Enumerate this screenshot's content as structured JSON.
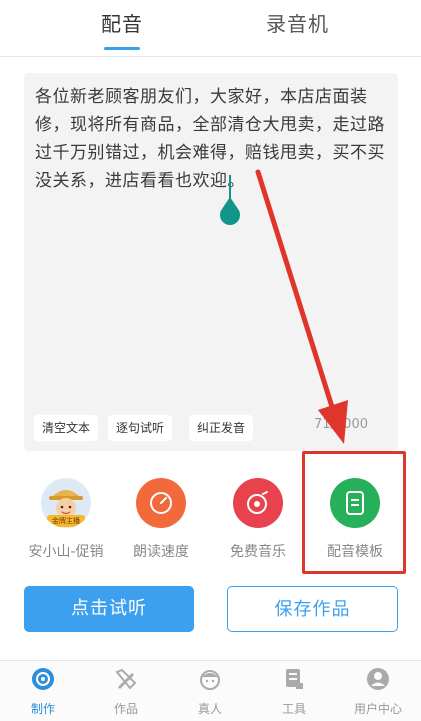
{
  "top_tabs": [
    "配音",
    "录音机"
  ],
  "editor": {
    "text": "各位新老顾客朋友们，大家好，本店店面装修，现将所有商品，全部清仓大甩卖，走过路过千万别错过，机会难得，赔钱甩卖，买不买没关系，进店看看也欢迎。",
    "chips": [
      "清空文本",
      "逐句试听",
      "纠正发音"
    ],
    "counter": "71/5000"
  },
  "features": [
    {
      "label": "安小山-促销",
      "badge": "金牌主播"
    },
    {
      "label": "朗读速度"
    },
    {
      "label": "免费音乐"
    },
    {
      "label": "配音模板"
    }
  ],
  "buttons": {
    "preview": "点击试听",
    "save": "保存作品"
  },
  "bottom_nav": [
    "制作",
    "作品",
    "真人",
    "工具",
    "用户中心"
  ],
  "colors": {
    "accent": "#3da0ef",
    "highlight": "#e0352b",
    "caret": "#12958a"
  }
}
